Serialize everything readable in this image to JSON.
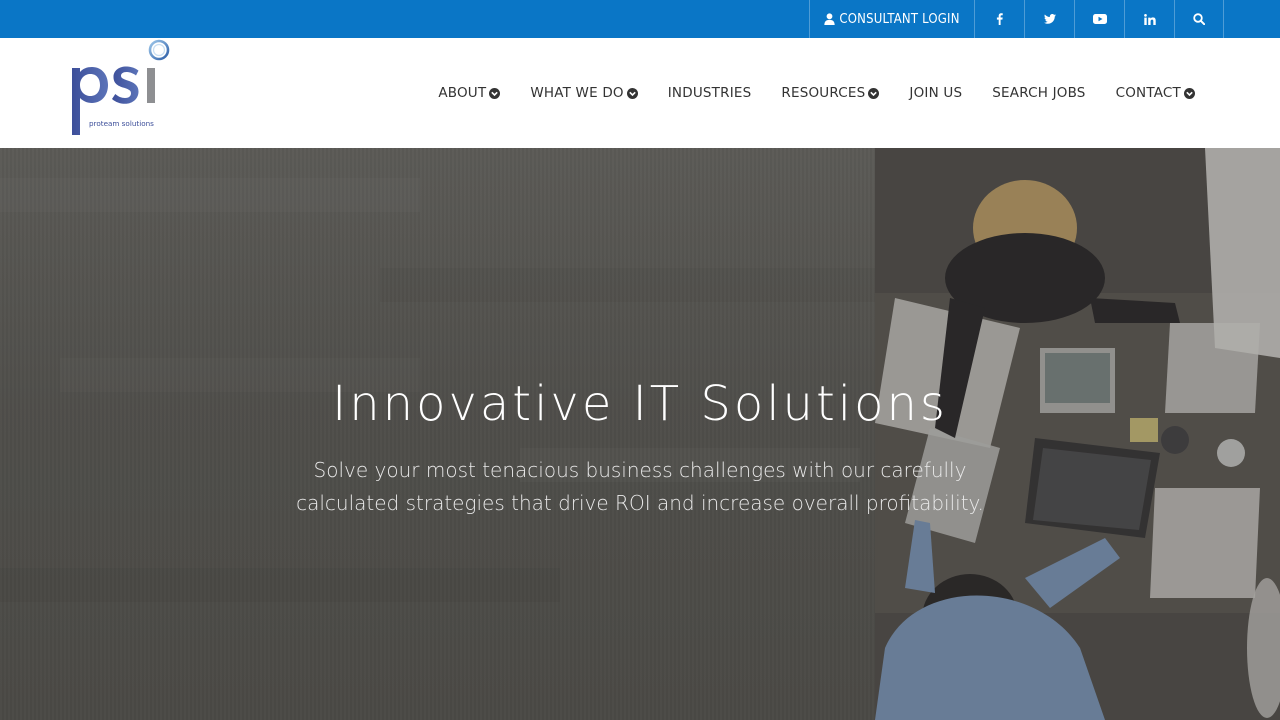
{
  "topbar": {
    "login_label": "CONSULTANT LOGIN",
    "social": [
      {
        "icon": "facebook-icon"
      },
      {
        "icon": "twitter-icon"
      },
      {
        "icon": "youtube-icon"
      },
      {
        "icon": "linkedin-icon"
      }
    ],
    "search_icon": "search-icon"
  },
  "logo": {
    "wordmark": "psi",
    "tagline": "proteam solutions"
  },
  "nav": {
    "items": [
      {
        "label": "ABOUT",
        "dropdown": true
      },
      {
        "label": "WHAT WE DO",
        "dropdown": true
      },
      {
        "label": "INDUSTRIES",
        "dropdown": false
      },
      {
        "label": "RESOURCES",
        "dropdown": true
      },
      {
        "label": "JOIN US",
        "dropdown": false
      },
      {
        "label": "SEARCH JOBS",
        "dropdown": false
      },
      {
        "label": "CONTACT",
        "dropdown": true
      }
    ]
  },
  "hero": {
    "title": "Innovative IT Solutions",
    "subtitle_line1": "Solve your most tenacious business challenges with our carefully",
    "subtitle_line2": "calculated strategies that drive ROI and increase overall profitability."
  },
  "colors": {
    "topbar": "#0a76c6",
    "nav_text": "#333333",
    "hero_overlay": "#52514d"
  }
}
